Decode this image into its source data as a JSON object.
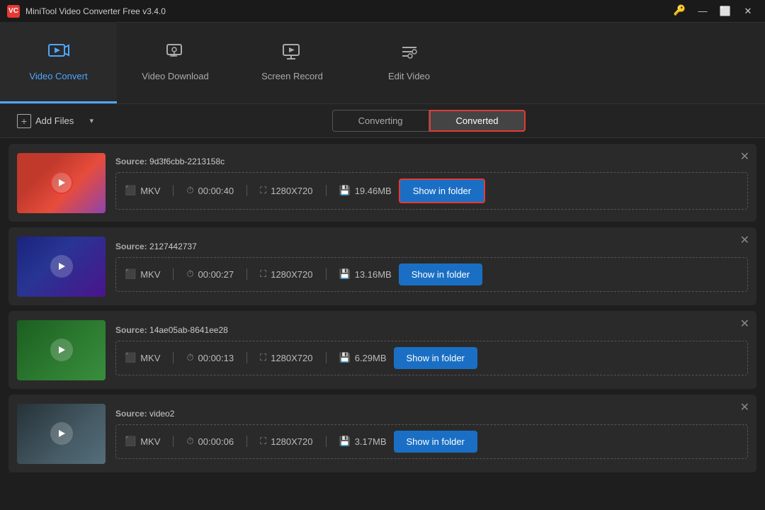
{
  "app": {
    "title": "MiniTool Video Converter Free v3.4.0",
    "logo_text": "VC"
  },
  "titlebar": {
    "minimize": "—",
    "maximize": "⬜",
    "close": "✕",
    "key_icon": "🔑"
  },
  "nav": {
    "items": [
      {
        "id": "video-convert",
        "label": "Video Convert",
        "icon": "▶",
        "active": true
      },
      {
        "id": "video-download",
        "label": "Video Download",
        "icon": "⬇",
        "active": false
      },
      {
        "id": "screen-record",
        "label": "Screen Record",
        "icon": "📷",
        "active": false
      },
      {
        "id": "edit-video",
        "label": "Edit Video",
        "icon": "✂",
        "active": false
      }
    ]
  },
  "toolbar": {
    "add_files_label": "Add Files",
    "tabs": [
      {
        "id": "converting",
        "label": "Converting",
        "active": false
      },
      {
        "id": "converted",
        "label": "Converted",
        "active": true
      }
    ]
  },
  "videos": [
    {
      "id": 1,
      "source_label": "Source:",
      "source_value": "9d3f6cbb-2213158c",
      "format": "MKV",
      "duration": "00:00:40",
      "resolution": "1280X720",
      "size": "19.46MB",
      "show_folder_label": "Show in folder",
      "thumb_class": "thumb-1",
      "highlight": true
    },
    {
      "id": 2,
      "source_label": "Source:",
      "source_value": "2127442737",
      "format": "MKV",
      "duration": "00:00:27",
      "resolution": "1280X720",
      "size": "13.16MB",
      "show_folder_label": "Show in folder",
      "thumb_class": "thumb-2",
      "highlight": false
    },
    {
      "id": 3,
      "source_label": "Source:",
      "source_value": "14ae05ab-8641ee28",
      "format": "MKV",
      "duration": "00:00:13",
      "resolution": "1280X720",
      "size": "6.29MB",
      "show_folder_label": "Show in folder",
      "thumb_class": "thumb-3",
      "highlight": false
    },
    {
      "id": 4,
      "source_label": "Source:",
      "source_value": "video2",
      "format": "MKV",
      "duration": "00:00:06",
      "resolution": "1280X720",
      "size": "3.17MB",
      "show_folder_label": "Show in folder",
      "thumb_class": "thumb-4",
      "highlight": false
    }
  ]
}
